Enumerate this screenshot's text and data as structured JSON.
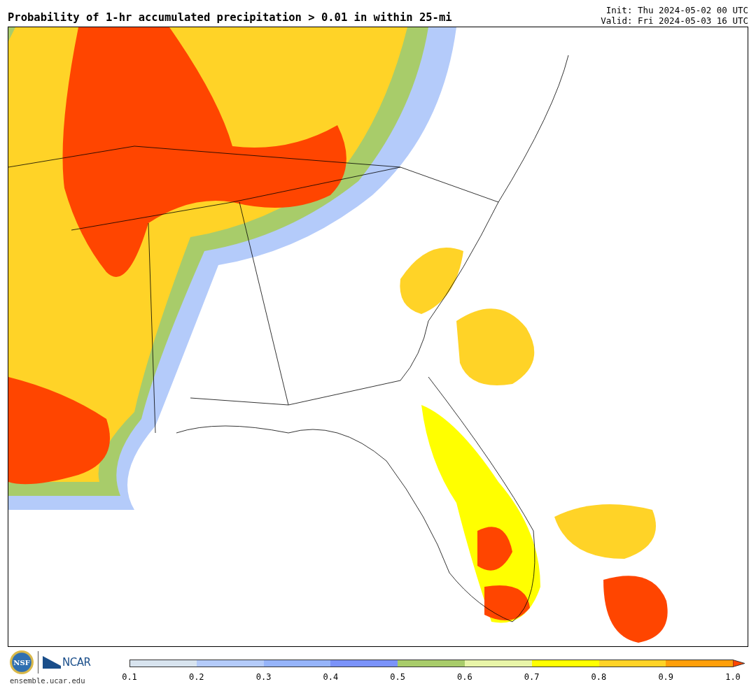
{
  "title": "Probability of 1-hr accumulated precipitation > 0.01 in within 25-mi",
  "init": "Init: Thu 2024-05-02 00 UTC",
  "valid": "Valid: Fri 2024-05-03 16 UTC",
  "logos": {
    "nsf": "NSF",
    "ncar": "NCAR",
    "url": "ensemble.ucar.edu"
  },
  "colorbar": {
    "bins": [
      {
        "kind": "band",
        "color": "#d8e4ef"
      },
      {
        "kind": "band",
        "color": "#b4cbfa"
      },
      {
        "kind": "band",
        "color": "#96b4fa"
      },
      {
        "kind": "band",
        "color": "#7b93fa"
      },
      {
        "kind": "band",
        "color": "#a8cc6a"
      },
      {
        "kind": "band",
        "color": "#e8f5a8"
      },
      {
        "kind": "band",
        "color": "#ffff00"
      },
      {
        "kind": "band",
        "color": "#ffd327"
      },
      {
        "kind": "band",
        "color": "#ff9f0a"
      },
      {
        "kind": "arrow",
        "color": "#ff4500"
      }
    ],
    "ticks": [
      "0.1",
      "0.2",
      "0.3",
      "0.4",
      "0.5",
      "0.6",
      "0.7",
      "0.8",
      "0.9",
      "1.0"
    ]
  }
}
